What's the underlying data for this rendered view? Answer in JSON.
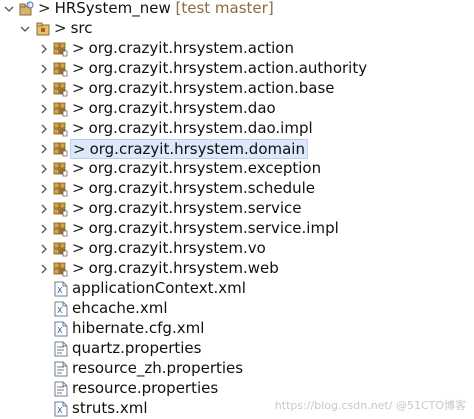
{
  "tree": {
    "project": {
      "prefix": ">",
      "name": "HRSystem_new",
      "branch": "[test master]"
    },
    "src": {
      "prefix": ">",
      "name": "src"
    },
    "packages": [
      {
        "prefix": ">",
        "name": "org.crazyit.hrsystem.action"
      },
      {
        "prefix": ">",
        "name": "org.crazyit.hrsystem.action.authority"
      },
      {
        "prefix": ">",
        "name": "org.crazyit.hrsystem.action.base"
      },
      {
        "prefix": ">",
        "name": "org.crazyit.hrsystem.dao"
      },
      {
        "prefix": ">",
        "name": "org.crazyit.hrsystem.dao.impl"
      },
      {
        "prefix": ">",
        "name": "org.crazyit.hrsystem.domain"
      },
      {
        "prefix": ">",
        "name": "org.crazyit.hrsystem.exception"
      },
      {
        "prefix": ">",
        "name": "org.crazyit.hrsystem.schedule"
      },
      {
        "prefix": ">",
        "name": "org.crazyit.hrsystem.service"
      },
      {
        "prefix": ">",
        "name": "org.crazyit.hrsystem.service.impl"
      },
      {
        "prefix": ">",
        "name": "org.crazyit.hrsystem.vo"
      },
      {
        "prefix": ">",
        "name": "org.crazyit.hrsystem.web"
      }
    ],
    "files": [
      {
        "name": "applicationContext.xml"
      },
      {
        "name": "ehcache.xml"
      },
      {
        "name": "hibernate.cfg.xml"
      },
      {
        "name": "quartz.properties"
      },
      {
        "name": "resource_zh.properties"
      },
      {
        "name": "resource.properties"
      },
      {
        "name": "struts.xml"
      }
    ],
    "selected_package": "org.crazyit.hrsystem.domain"
  },
  "watermark": "https://blog.csdn.net/ @51CTO博客",
  "colors": {
    "selection_bg": "#dbe9f9",
    "selection_border": "#b7d1ef",
    "branch_text": "#8a6d3b",
    "package_icon": "#c8a24a",
    "xml_icon": "#ffffff",
    "properties_icon": "#ffffff"
  }
}
